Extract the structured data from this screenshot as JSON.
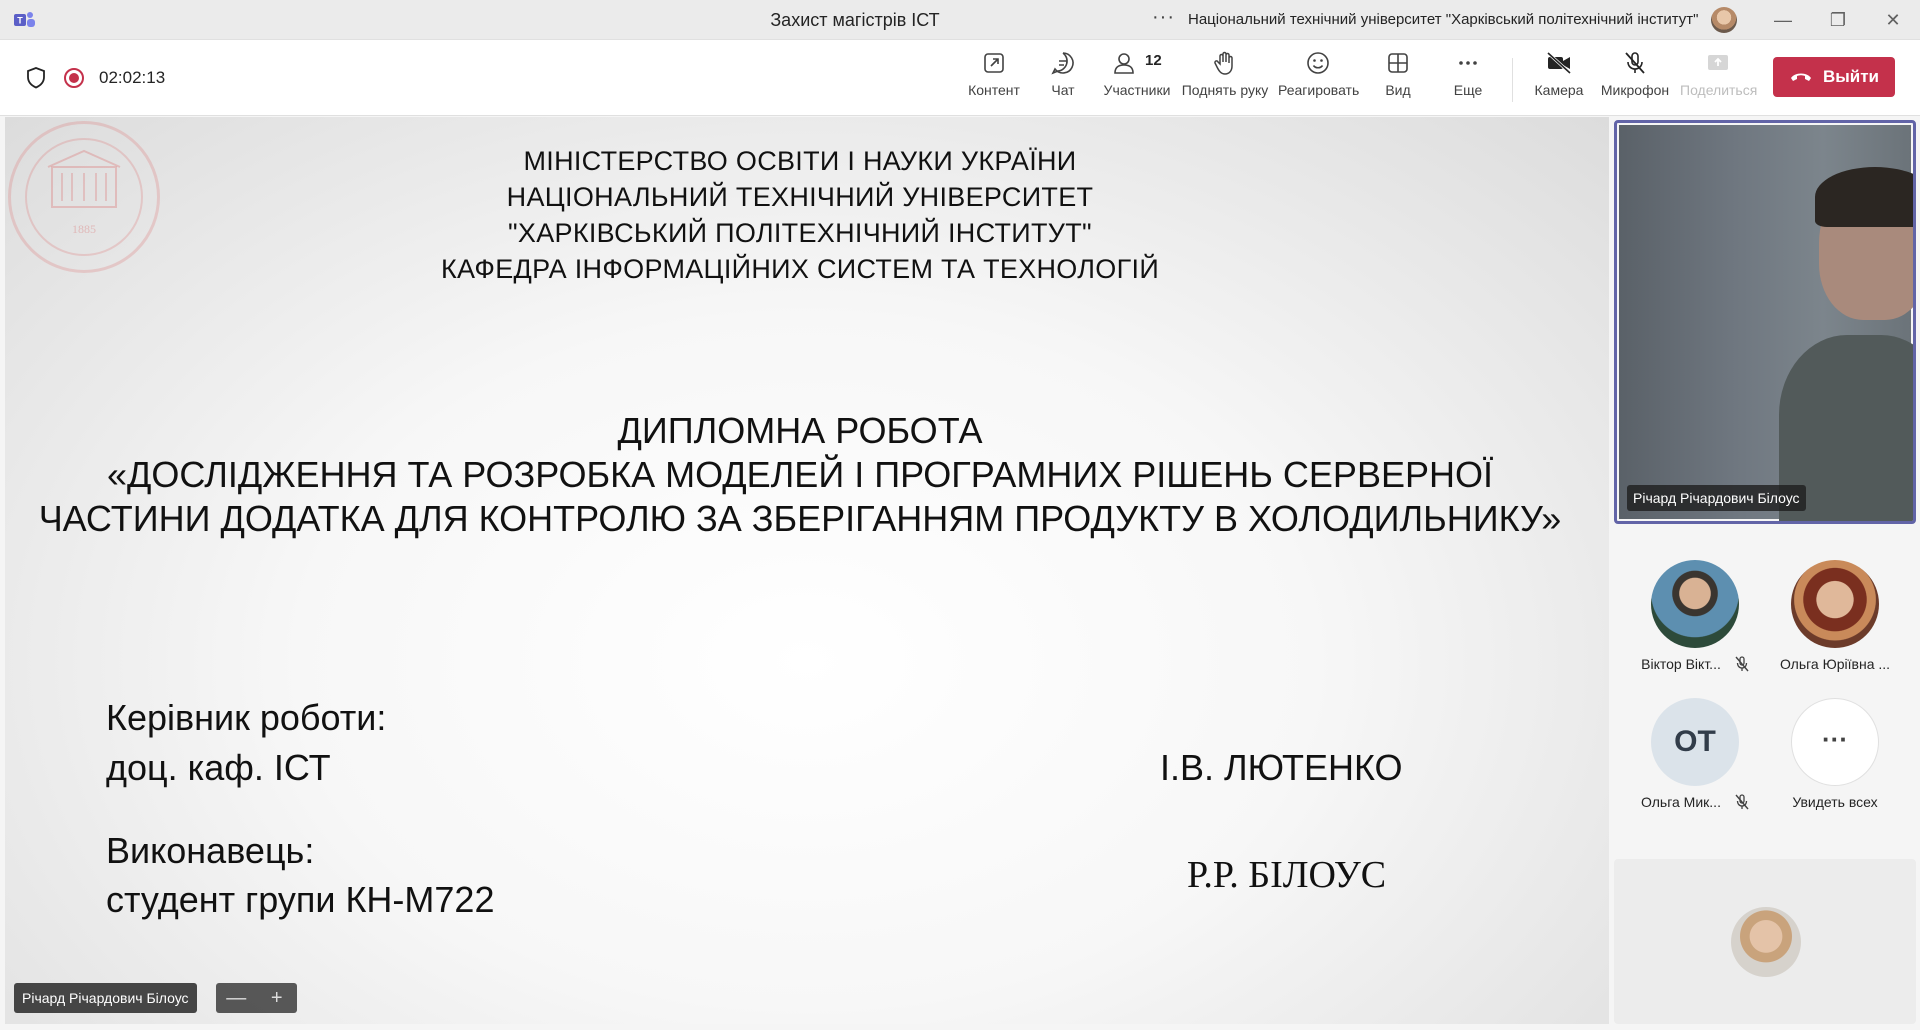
{
  "window": {
    "title": "Захист магістрів ІСТ",
    "more_dots": "···",
    "org_name": "Національний технічний університет \"Харківський політехнічний інститут\"",
    "min": "—",
    "restore": "❐",
    "close": "✕"
  },
  "toolbar": {
    "timer": "02:02:13",
    "items": [
      {
        "label": "Контент"
      },
      {
        "label": "Чат"
      },
      {
        "label": "Участники",
        "count": "12"
      },
      {
        "label": "Поднять руку"
      },
      {
        "label": "Реагировать"
      },
      {
        "label": "Вид"
      },
      {
        "label": "Еще"
      },
      {
        "label": "Камера"
      },
      {
        "label": "Микрофон"
      },
      {
        "label": "Поделиться"
      }
    ],
    "leave_label": "Выйти",
    "leave_color": "#c4314b"
  },
  "slide": {
    "header_lines": [
      "МІНІСТЕРСТВО ОСВІТИ І НАУКИ УКРАЇНИ",
      "НАЦІОНАЛЬНИЙ ТЕХНІЧНИЙ УНІВЕРСИТЕТ",
      "\"ХАРКІВСЬКИЙ ПОЛІТЕХНІЧНИЙ ІНСТИТУТ\"",
      "КАФЕДРА ІНФОРМАЦІЙНИХ СИСТЕМ ТА ТЕХНОЛОГІЙ"
    ],
    "title_lines": [
      "ДИПЛОМНА РОБОТА",
      "«ДОСЛІДЖЕННЯ ТА РОЗРОБКА МОДЕЛЕЙ І ПРОГРАМНИХ РІШЕНЬ СЕРВЕРНОЇ",
      "ЧАСТИНИ ДОДАТКА ДЛЯ КОНТРОЛЮ ЗА ЗБЕРІГАННЯМ ПРОДУКТУ В ХОЛОДИЛЬНИКУ»"
    ],
    "supervisor_label": "Керівник роботи:",
    "supervisor_position": "доц. каф. ІСТ",
    "supervisor_name": "І.В. ЛЮТЕНКО",
    "author_label": "Виконавець:",
    "author_group": "студент групи КН-М722",
    "author_name": "Р.Р. БІЛОУС",
    "seal_year": "1885"
  },
  "stage": {
    "presenter_name": "Річард Річардович Білоус",
    "zoom_out": "—",
    "zoom_in": "+"
  },
  "right_panel": {
    "video_name": "Річард Річардович Білоус",
    "participants": [
      {
        "name": "Віктор Вікт...",
        "muted": true
      },
      {
        "name": "Ольга Юріївна ...",
        "muted": false
      },
      {
        "name": "Ольга Мик...",
        "muted": true,
        "initials": "ОТ"
      },
      {
        "name": "Увидеть всех",
        "see_all": "···"
      }
    ]
  }
}
